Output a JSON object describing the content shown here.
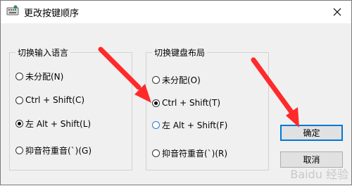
{
  "window": {
    "title": "更改按键顺序"
  },
  "left_group": {
    "title": "切换输入语言",
    "options": [
      {
        "label": "未分配(N)",
        "selected": false
      },
      {
        "label": "Ctrl + Shift(C)",
        "selected": false
      },
      {
        "label": "左 Alt + Shift(L)",
        "selected": true
      },
      {
        "label": "抑音符重音(`)(G)",
        "selected": false
      }
    ]
  },
  "right_group": {
    "title": "切换键盘布局",
    "options": [
      {
        "label": "未分配(O)",
        "selected": false
      },
      {
        "label": "Ctrl + Shift(T)",
        "selected": true
      },
      {
        "label": "左 Alt + Shift(F)",
        "selected": false,
        "hover": true
      },
      {
        "label": "抑音符重音(`)(R)",
        "selected": false
      }
    ]
  },
  "buttons": {
    "ok": "确定",
    "cancel": "取消"
  },
  "colors": {
    "window_bg": "#f0f0f0",
    "default_button_border": "#0078d7",
    "annotation_arrow": "#ff2a2a"
  },
  "watermark": "Baidu 经验"
}
